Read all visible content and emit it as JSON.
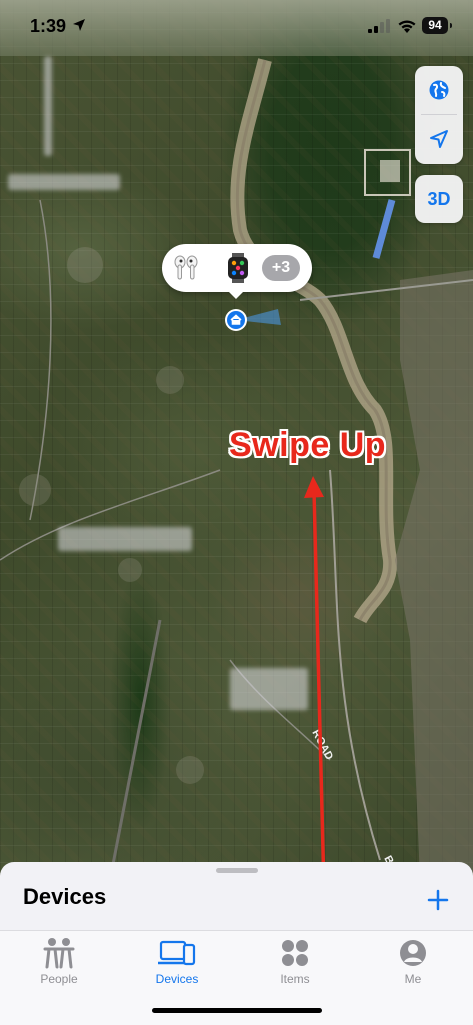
{
  "status_bar": {
    "time": "1:39",
    "battery": "94"
  },
  "map": {
    "road_label": "ROAD",
    "road_edge_label": "B"
  },
  "controls": {
    "three_d_label": "3D"
  },
  "device_bubble": {
    "more_count": "+3"
  },
  "annotation": {
    "text": "Swipe Up",
    "color": "#e8281c"
  },
  "sheet": {
    "title": "Devices"
  },
  "tabs": [
    {
      "label": "People",
      "icon": "people-icon",
      "active": false
    },
    {
      "label": "Devices",
      "icon": "devices-icon",
      "active": true
    },
    {
      "label": "Items",
      "icon": "items-icon",
      "active": false
    },
    {
      "label": "Me",
      "icon": "me-icon",
      "active": false
    }
  ],
  "colors": {
    "accent": "#1476ec",
    "inactive": "#8e8e93"
  }
}
